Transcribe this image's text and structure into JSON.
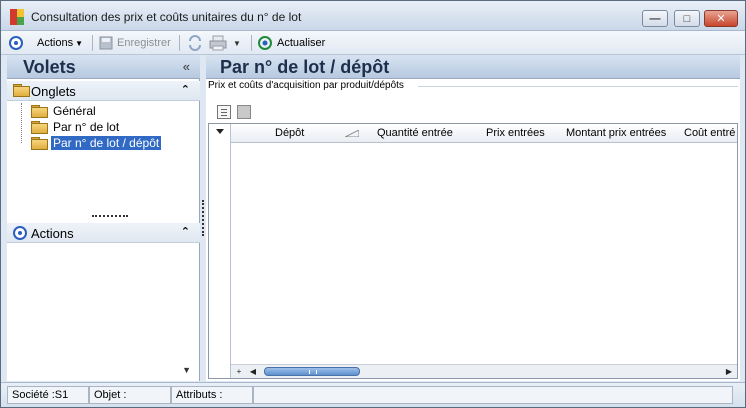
{
  "window": {
    "title": "Consultation des prix et coûts unitaires du n° de lot",
    "min_symbol": "—",
    "max_symbol": "□",
    "close_symbol": "✕"
  },
  "toolbar": {
    "actions_label": "Actions",
    "save_label": "Enregistrer",
    "refresh_label": "Actualiser"
  },
  "left_panel": {
    "title": "Volets",
    "collapse_symbol": "«",
    "onglets": {
      "title": "Onglets",
      "chevron": "⌃",
      "items": [
        {
          "label": "Général",
          "selected": false
        },
        {
          "label": "Par n° de lot",
          "selected": false
        },
        {
          "label": "Par n° de lot / dépôt",
          "selected": true
        }
      ]
    },
    "actions": {
      "title": "Actions",
      "chevron": "⌃"
    },
    "scroll_down_symbol": "▼"
  },
  "main": {
    "title": "Par n° de lot / dépôt",
    "group_label": "Prix et coûts d'acquisition par produit/dépôts",
    "grid": {
      "columns": [
        "Dépôt",
        "Quantité entrée",
        "Prix entrées",
        "Montant prix entrées",
        "Coût entré"
      ],
      "rows": []
    },
    "scrollbar": {
      "add_symbol": "+",
      "left_symbol": "◀",
      "right_symbol": "▶"
    }
  },
  "status": {
    "societe": "Société :S1",
    "objet": "Objet :",
    "attributs": "Attributs :"
  },
  "colors": {
    "accent": "#316ac5",
    "header_gradient_top": "#d7e3f2",
    "header_gradient_bottom": "#b7c9df",
    "title_text": "#1d2f4a"
  }
}
